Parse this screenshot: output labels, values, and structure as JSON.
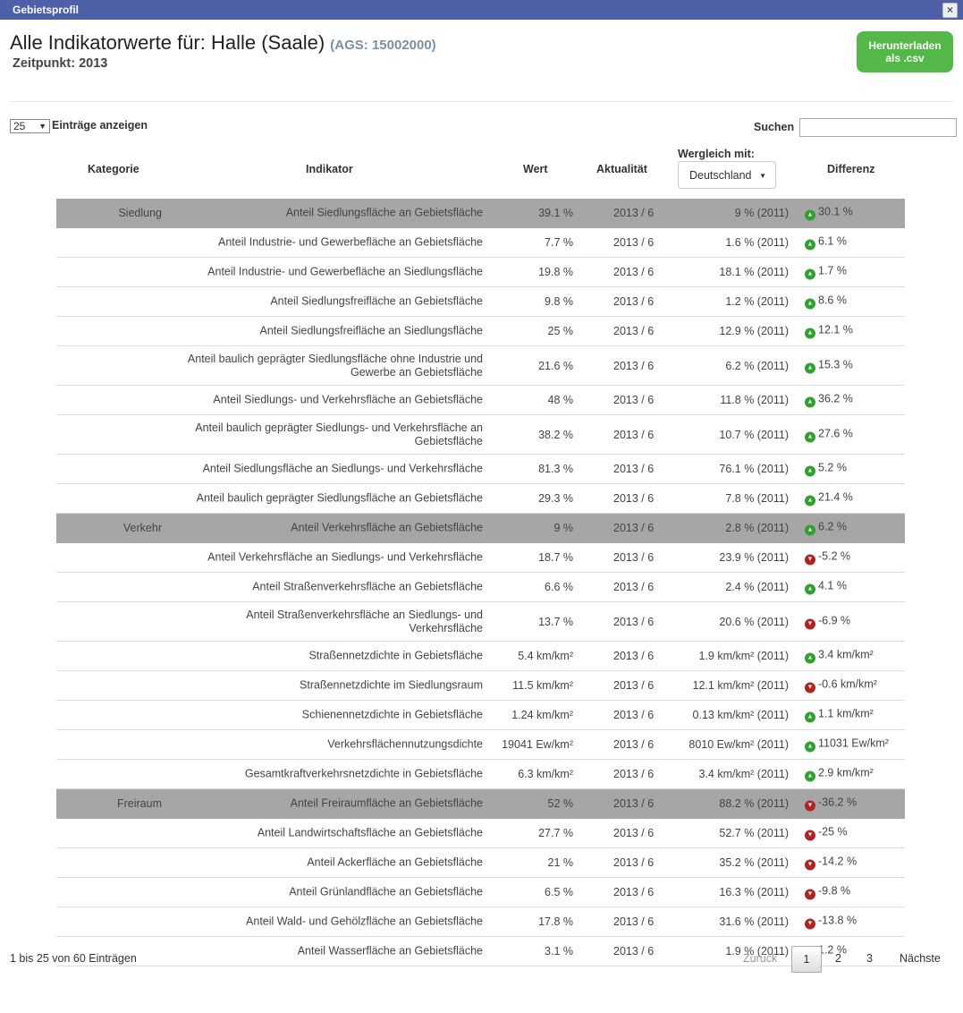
{
  "window": {
    "title": "Gebietsprofil",
    "close": "×"
  },
  "header": {
    "title": "Alle Indikatorwerte für:  Halle (Saale)",
    "ags": "(AGS: 15002000)",
    "subtitle": "Zeitpunkt: 2013",
    "download_line1": "Herunterladen",
    "download_line2": "als .csv"
  },
  "controls": {
    "length_value": "25",
    "length_label": "Einträge anzeigen",
    "search_label": "Suchen",
    "search_value": ""
  },
  "columns": {
    "kategorie": "Kategorie",
    "indikator": "Indikator",
    "wert": "Wert",
    "aktualitaet": "Aktualität",
    "vergleich_label": "Wergleich mit:",
    "vergleich_value": "Deutschland",
    "differenz": "Differenz"
  },
  "rows": [
    {
      "cat": "Siedlung",
      "ind": "Anteil Siedlungsfläche an Gebietsfläche",
      "wert": "39.1 %",
      "akt": "2013 / 6",
      "vgl": "9 % (2011)",
      "dir": "up",
      "diff": "30.1 %"
    },
    {
      "cat": "",
      "ind": "Anteil Industrie- und Gewerbefläche an Gebietsfläche",
      "wert": "7.7 %",
      "akt": "2013 / 6",
      "vgl": "1.6 % (2011)",
      "dir": "up",
      "diff": "6.1 %"
    },
    {
      "cat": "",
      "ind": "Anteil Industrie- und Gewerbefläche an Siedlungsfläche",
      "wert": "19.8 %",
      "akt": "2013 / 6",
      "vgl": "18.1 % (2011)",
      "dir": "up",
      "diff": "1.7 %"
    },
    {
      "cat": "",
      "ind": "Anteil Siedlungsfreifläche an Gebietsfläche",
      "wert": "9.8 %",
      "akt": "2013 / 6",
      "vgl": "1.2 % (2011)",
      "dir": "up",
      "diff": "8.6 %"
    },
    {
      "cat": "",
      "ind": "Anteil Siedlungsfreifläche an Siedlungsfläche",
      "wert": "25 %",
      "akt": "2013 / 6",
      "vgl": "12.9 % (2011)",
      "dir": "up",
      "diff": "12.1 %"
    },
    {
      "cat": "",
      "ind": "Anteil baulich geprägter Siedlungsfläche ohne Industrie und Gewerbe an Gebietsfläche",
      "wert": "21.6 %",
      "akt": "2013 / 6",
      "vgl": "6.2 % (2011)",
      "dir": "up",
      "diff": "15.3 %"
    },
    {
      "cat": "",
      "ind": "Anteil Siedlungs- und Verkehrsfläche an Gebietsfläche",
      "wert": "48 %",
      "akt": "2013 / 6",
      "vgl": "11.8 % (2011)",
      "dir": "up",
      "diff": "36.2 %"
    },
    {
      "cat": "",
      "ind": "Anteil baulich geprägter Siedlungs- und Verkehrsfläche an Gebietsfläche",
      "wert": "38.2 %",
      "akt": "2013 / 6",
      "vgl": "10.7 % (2011)",
      "dir": "up",
      "diff": "27.6 %"
    },
    {
      "cat": "",
      "ind": "Anteil Siedlungsfläche an Siedlungs- und Verkehrsfläche",
      "wert": "81.3 %",
      "akt": "2013 / 6",
      "vgl": "76.1 % (2011)",
      "dir": "up",
      "diff": "5.2 %"
    },
    {
      "cat": "",
      "ind": "Anteil baulich geprägter Siedlungsfläche an Gebietsfläche",
      "wert": "29.3 %",
      "akt": "2013 / 6",
      "vgl": "7.8 % (2011)",
      "dir": "up",
      "diff": "21.4 %"
    },
    {
      "cat": "Verkehr",
      "ind": "Anteil Verkehrsfläche an Gebietsfläche",
      "wert": "9 %",
      "akt": "2013 / 6",
      "vgl": "2.8 % (2011)",
      "dir": "up",
      "diff": "6.2 %"
    },
    {
      "cat": "",
      "ind": "Anteil Verkehrsfläche an Siedlungs- und Verkehrsfläche",
      "wert": "18.7 %",
      "akt": "2013 / 6",
      "vgl": "23.9 % (2011)",
      "dir": "down",
      "diff": "-5.2 %"
    },
    {
      "cat": "",
      "ind": "Anteil Straßenverkehrsfläche an Gebietsfläche",
      "wert": "6.6 %",
      "akt": "2013 / 6",
      "vgl": "2.4 % (2011)",
      "dir": "up",
      "diff": "4.1 %"
    },
    {
      "cat": "",
      "ind": "Anteil Straßenverkehrsfläche an Siedlungs- und Verkehrsfläche",
      "wert": "13.7 %",
      "akt": "2013 / 6",
      "vgl": "20.6 % (2011)",
      "dir": "down",
      "diff": "-6.9 %"
    },
    {
      "cat": "",
      "ind": "Straßennetzdichte in Gebietsfläche",
      "wert": "5.4 km/km²",
      "akt": "2013 / 6",
      "vgl": "1.9 km/km² (2011)",
      "dir": "up",
      "diff": "3.4 km/km²"
    },
    {
      "cat": "",
      "ind": "Straßennetzdichte im Siedlungsraum",
      "wert": "11.5 km/km²",
      "akt": "2013 / 6",
      "vgl": "12.1 km/km² (2011)",
      "dir": "down",
      "diff": "-0.6 km/km²"
    },
    {
      "cat": "",
      "ind": "Schienennetzdichte in Gebietsfläche",
      "wert": "1.24 km/km²",
      "akt": "2013 / 6",
      "vgl": "0.13 km/km² (2011)",
      "dir": "up",
      "diff": "1.1 km/km²"
    },
    {
      "cat": "",
      "ind": "Verkehrsflächennutzungsdichte",
      "wert": "19041 Ew/km²",
      "akt": "2013 / 6",
      "vgl": "8010 Ew/km² (2011)",
      "dir": "up",
      "diff": "11031 Ew/km²"
    },
    {
      "cat": "",
      "ind": "Gesamtkraftverkehrsnetzdichte in Gebietsfläche",
      "wert": "6.3 km/km²",
      "akt": "2013 / 6",
      "vgl": "3.4 km/km² (2011)",
      "dir": "up",
      "diff": "2.9 km/km²"
    },
    {
      "cat": "Freiraum",
      "ind": "Anteil Freiraumfläche an Gebietsfläche",
      "wert": "52 %",
      "akt": "2013 / 6",
      "vgl": "88.2 % (2011)",
      "dir": "down",
      "diff": "-36.2 %"
    },
    {
      "cat": "",
      "ind": "Anteil Landwirtschaftsfläche an Gebietsfläche",
      "wert": "27.7 %",
      "akt": "2013 / 6",
      "vgl": "52.7 % (2011)",
      "dir": "down",
      "diff": "-25 %"
    },
    {
      "cat": "",
      "ind": "Anteil Ackerfläche an Gebietsfläche",
      "wert": "21 %",
      "akt": "2013 / 6",
      "vgl": "35.2 % (2011)",
      "dir": "down",
      "diff": "-14.2 %"
    },
    {
      "cat": "",
      "ind": "Anteil Grünlandfläche an Gebietsfläche",
      "wert": "6.5 %",
      "akt": "2013 / 6",
      "vgl": "16.3 % (2011)",
      "dir": "down",
      "diff": "-9.8 %"
    },
    {
      "cat": "",
      "ind": "Anteil Wald- und Gehölzfläche an Gebietsfläche",
      "wert": "17.8 %",
      "akt": "2013 / 6",
      "vgl": "31.6 % (2011)",
      "dir": "down",
      "diff": "-13.8 %"
    },
    {
      "cat": "",
      "ind": "Anteil Wasserfläche an Gebietsfläche",
      "wert": "3.1 %",
      "akt": "2013 / 6",
      "vgl": "1.9 % (2011)",
      "dir": "up",
      "diff": "1.2 %"
    }
  ],
  "footer": {
    "info": "1 bis 25 von 60 Einträgen",
    "prev": "Zurück",
    "pages": [
      "1",
      "2",
      "3"
    ],
    "next": "Nächste"
  }
}
